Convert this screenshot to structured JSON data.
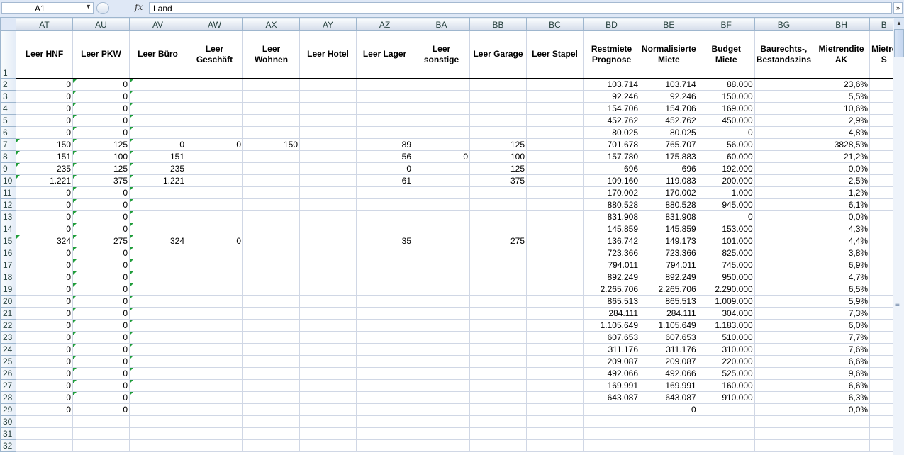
{
  "formula_bar": {
    "name_box": "A1",
    "fx_label": "fx",
    "formula": "Land"
  },
  "columns": [
    "AT",
    "AU",
    "AV",
    "AW",
    "AX",
    "AY",
    "AZ",
    "BA",
    "BB",
    "BC",
    "BD",
    "BE",
    "BF",
    "BG",
    "BH",
    "B"
  ],
  "headers": [
    "Leer HNF",
    "Leer PKW",
    "Leer Büro",
    "Leer Geschäft",
    "Leer Wohnen",
    "Leer Hotel",
    "Leer Lager",
    "Leer sonstige",
    "Leer Garage",
    "Leer Stapel",
    "Restmiete Prognose",
    "Normalisierte Miete",
    "Budget Miete",
    "Baurechts-, Bestandszins",
    "Mietrendite AK",
    "Mietre S"
  ],
  "rows": [
    {
      "n": "2",
      "c": [
        "0",
        "0",
        "",
        "",
        "",
        "",
        "",
        "",
        "",
        "",
        "103.714",
        "103.714",
        "88.000",
        "",
        "23,6%",
        ""
      ]
    },
    {
      "n": "3",
      "c": [
        "0",
        "0",
        "",
        "",
        "",
        "",
        "",
        "",
        "",
        "",
        "92.246",
        "92.246",
        "150.000",
        "",
        "5,5%",
        ""
      ]
    },
    {
      "n": "4",
      "c": [
        "0",
        "0",
        "",
        "",
        "",
        "",
        "",
        "",
        "",
        "",
        "154.706",
        "154.706",
        "169.000",
        "",
        "10,6%",
        ""
      ]
    },
    {
      "n": "5",
      "c": [
        "0",
        "0",
        "",
        "",
        "",
        "",
        "",
        "",
        "",
        "",
        "452.762",
        "452.762",
        "450.000",
        "",
        "2,9%",
        ""
      ]
    },
    {
      "n": "6",
      "c": [
        "0",
        "0",
        "",
        "",
        "",
        "",
        "",
        "",
        "",
        "",
        "80.025",
        "80.025",
        "0",
        "",
        "4,8%",
        ""
      ]
    },
    {
      "n": "7",
      "c": [
        "150",
        "125",
        "0",
        "0",
        "150",
        "",
        "89",
        "",
        "125",
        "",
        "701.678",
        "765.707",
        "56.000",
        "",
        "3828,5%",
        ""
      ]
    },
    {
      "n": "8",
      "c": [
        "151",
        "100",
        "151",
        "",
        "",
        "",
        "56",
        "0",
        "100",
        "",
        "157.780",
        "175.883",
        "60.000",
        "",
        "21,2%",
        ""
      ]
    },
    {
      "n": "9",
      "c": [
        "235",
        "125",
        "235",
        "",
        "",
        "",
        "0",
        "",
        "125",
        "",
        "696",
        "696",
        "192.000",
        "",
        "0,0%",
        ""
      ]
    },
    {
      "n": "10",
      "c": [
        "1.221",
        "375",
        "1.221",
        "",
        "",
        "",
        "61",
        "",
        "375",
        "",
        "109.160",
        "119.083",
        "200.000",
        "",
        "2,5%",
        ""
      ]
    },
    {
      "n": "11",
      "c": [
        "0",
        "0",
        "",
        "",
        "",
        "",
        "",
        "",
        "",
        "",
        "170.002",
        "170.002",
        "1.000",
        "",
        "1,2%",
        ""
      ]
    },
    {
      "n": "12",
      "c": [
        "0",
        "0",
        "",
        "",
        "",
        "",
        "",
        "",
        "",
        "",
        "880.528",
        "880.528",
        "945.000",
        "",
        "6,1%",
        ""
      ]
    },
    {
      "n": "13",
      "c": [
        "0",
        "0",
        "",
        "",
        "",
        "",
        "",
        "",
        "",
        "",
        "831.908",
        "831.908",
        "0",
        "",
        "0,0%",
        ""
      ]
    },
    {
      "n": "14",
      "c": [
        "0",
        "0",
        "",
        "",
        "",
        "",
        "",
        "",
        "",
        "",
        "145.859",
        "145.859",
        "153.000",
        "",
        "4,3%",
        ""
      ]
    },
    {
      "n": "15",
      "c": [
        "324",
        "275",
        "324",
        "0",
        "",
        "",
        "35",
        "",
        "275",
        "",
        "136.742",
        "149.173",
        "101.000",
        "",
        "4,4%",
        ""
      ]
    },
    {
      "n": "16",
      "c": [
        "0",
        "0",
        "",
        "",
        "",
        "",
        "",
        "",
        "",
        "",
        "723.366",
        "723.366",
        "825.000",
        "",
        "3,8%",
        ""
      ]
    },
    {
      "n": "17",
      "c": [
        "0",
        "0",
        "",
        "",
        "",
        "",
        "",
        "",
        "",
        "",
        "794.011",
        "794.011",
        "745.000",
        "",
        "6,9%",
        ""
      ]
    },
    {
      "n": "18",
      "c": [
        "0",
        "0",
        "",
        "",
        "",
        "",
        "",
        "",
        "",
        "",
        "892.249",
        "892.249",
        "950.000",
        "",
        "4,7%",
        ""
      ]
    },
    {
      "n": "19",
      "c": [
        "0",
        "0",
        "",
        "",
        "",
        "",
        "",
        "",
        "",
        "",
        "2.265.706",
        "2.265.706",
        "2.290.000",
        "",
        "6,5%",
        ""
      ]
    },
    {
      "n": "20",
      "c": [
        "0",
        "0",
        "",
        "",
        "",
        "",
        "",
        "",
        "",
        "",
        "865.513",
        "865.513",
        "1.009.000",
        "",
        "5,9%",
        ""
      ]
    },
    {
      "n": "21",
      "c": [
        "0",
        "0",
        "",
        "",
        "",
        "",
        "",
        "",
        "",
        "",
        "284.111",
        "284.111",
        "304.000",
        "",
        "7,3%",
        ""
      ]
    },
    {
      "n": "22",
      "c": [
        "0",
        "0",
        "",
        "",
        "",
        "",
        "",
        "",
        "",
        "",
        "1.105.649",
        "1.105.649",
        "1.183.000",
        "",
        "6,0%",
        ""
      ]
    },
    {
      "n": "23",
      "c": [
        "0",
        "0",
        "",
        "",
        "",
        "",
        "",
        "",
        "",
        "",
        "607.653",
        "607.653",
        "510.000",
        "",
        "7,7%",
        ""
      ]
    },
    {
      "n": "24",
      "c": [
        "0",
        "0",
        "",
        "",
        "",
        "",
        "",
        "",
        "",
        "",
        "311.176",
        "311.176",
        "310.000",
        "",
        "7,6%",
        ""
      ]
    },
    {
      "n": "25",
      "c": [
        "0",
        "0",
        "",
        "",
        "",
        "",
        "",
        "",
        "",
        "",
        "209.087",
        "209.087",
        "220.000",
        "",
        "6,6%",
        ""
      ]
    },
    {
      "n": "26",
      "c": [
        "0",
        "0",
        "",
        "",
        "",
        "",
        "",
        "",
        "",
        "",
        "492.066",
        "492.066",
        "525.000",
        "",
        "9,6%",
        ""
      ]
    },
    {
      "n": "27",
      "c": [
        "0",
        "0",
        "",
        "",
        "",
        "",
        "",
        "",
        "",
        "",
        "169.991",
        "169.991",
        "160.000",
        "",
        "6,6%",
        ""
      ]
    },
    {
      "n": "28",
      "c": [
        "0",
        "0",
        "",
        "",
        "",
        "",
        "",
        "",
        "",
        "",
        "643.087",
        "643.087",
        "910.000",
        "",
        "6,3%",
        ""
      ]
    },
    {
      "n": "29",
      "c": [
        "0",
        "0",
        "",
        "",
        "",
        "",
        "",
        "",
        "",
        "",
        "",
        "0",
        "",
        "",
        "0,0%",
        ""
      ]
    },
    {
      "n": "30",
      "c": [
        "",
        "",
        "",
        "",
        "",
        "",
        "",
        "",
        "",
        "",
        "",
        "",
        "",
        "",
        "",
        ""
      ]
    },
    {
      "n": "31",
      "c": [
        "",
        "",
        "",
        "",
        "",
        "",
        "",
        "",
        "",
        "",
        "",
        "",
        "",
        "",
        "",
        ""
      ]
    },
    {
      "n": "32",
      "c": [
        "",
        "",
        "",
        "",
        "",
        "",
        "",
        "",
        "",
        "",
        "",
        "",
        "",
        "",
        "",
        ""
      ]
    }
  ]
}
